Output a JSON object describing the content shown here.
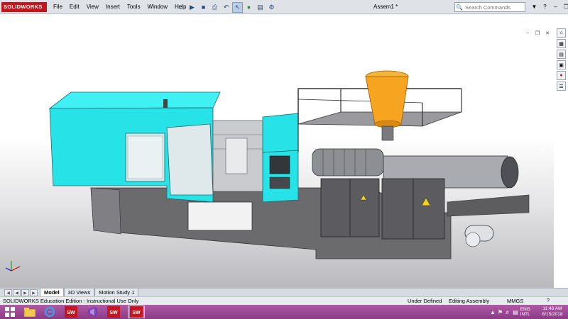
{
  "app": {
    "logo_text": "SOLIDWORKS",
    "document_title": "Assem1 *"
  },
  "menu": {
    "items": [
      "File",
      "Edit",
      "View",
      "Insert",
      "Tools",
      "Window",
      "Help"
    ]
  },
  "quick_toolbar": {
    "icons": [
      "new-document-icon",
      "open-icon",
      "save-icon",
      "print-icon",
      "undo-icon",
      "select-icon",
      "rebuild-icon",
      "file-properties-icon",
      "options-icon"
    ]
  },
  "search": {
    "placeholder": "Search Commands"
  },
  "tabs": [
    {
      "label": "Model",
      "active": true
    },
    {
      "label": "3D Views",
      "active": false
    },
    {
      "label": "Motion Study 1",
      "active": false
    }
  ],
  "status": {
    "edition": "SOLIDWORKS Education Edition - Instructional Use Only",
    "defined": "Under Defined",
    "mode": "Editing Assembly",
    "units": "MMGS"
  },
  "taskbar": {
    "language_top": "ENG",
    "language_bottom": "INTL",
    "time": "11:48 AM",
    "date": "6/15/2018",
    "sw_badge": "SW 2015"
  },
  "colors": {
    "brand_red": "#c4161c",
    "machine_cyan": "#27e3e8",
    "hopper_orange": "#f7a521",
    "taskbar_purple": "#9c4a96"
  }
}
